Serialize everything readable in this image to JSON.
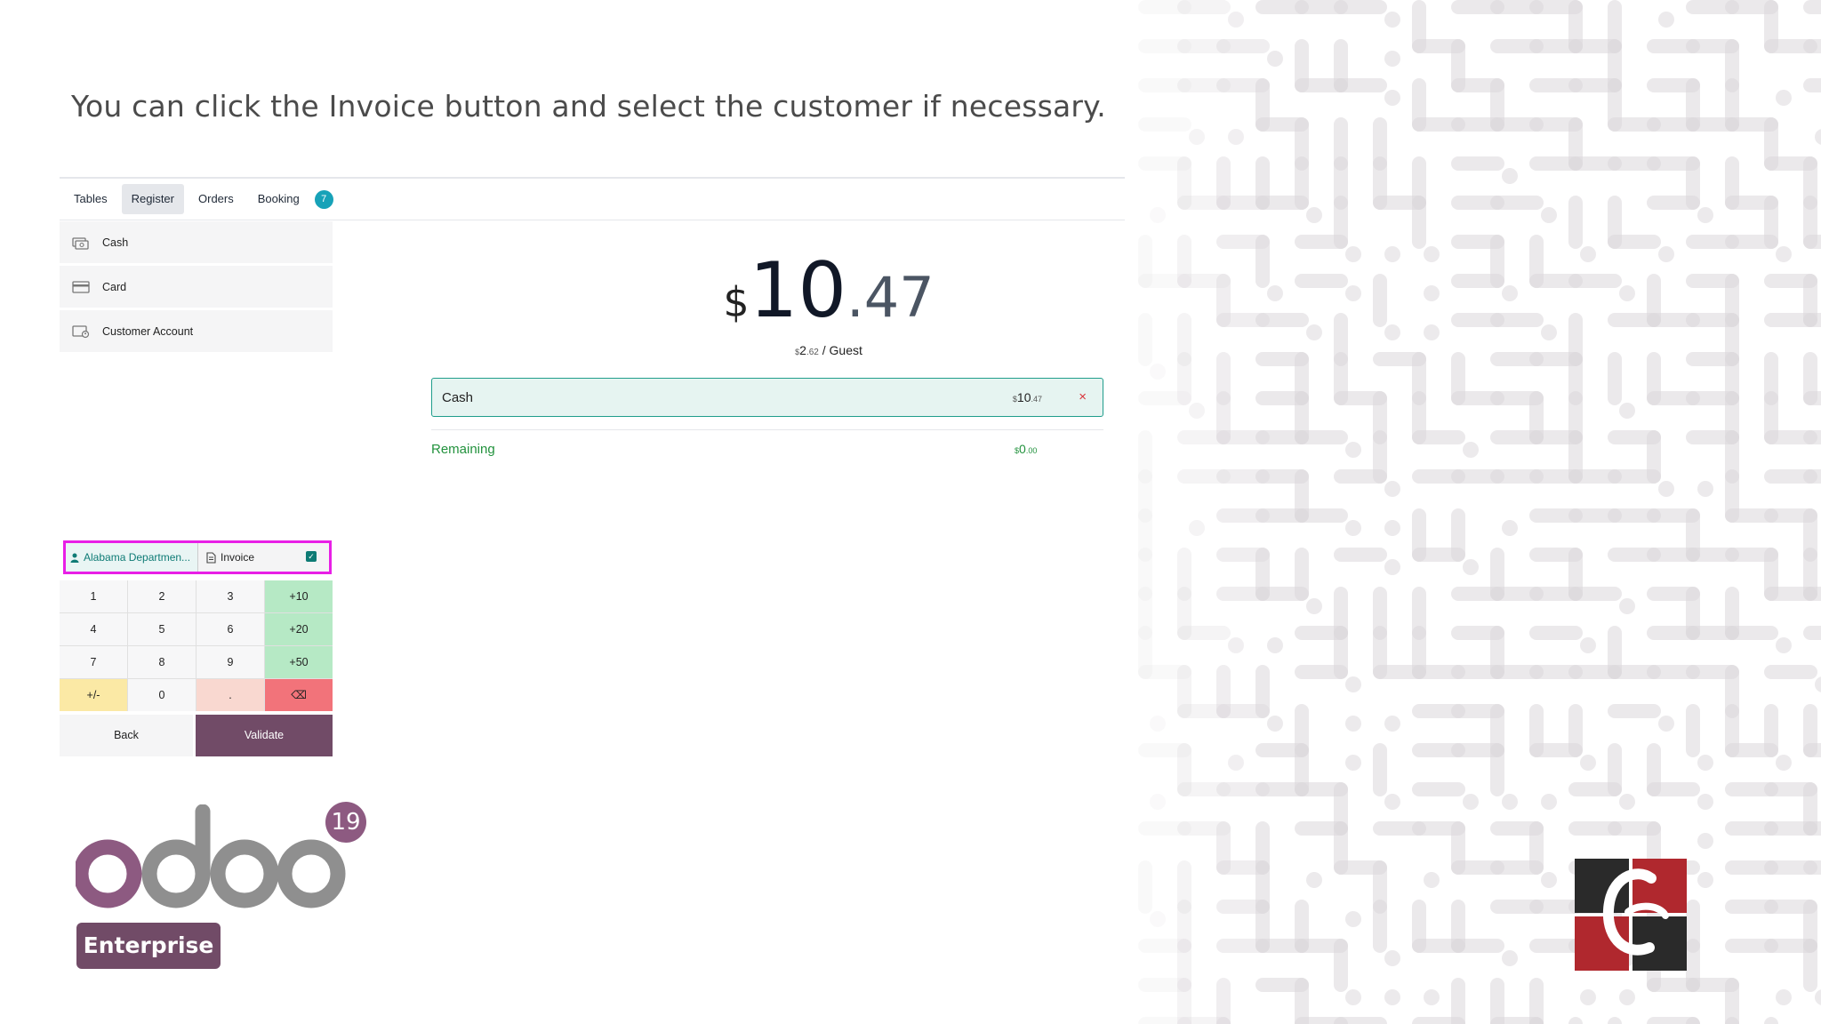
{
  "caption": "You can click the Invoice button and select the customer if necessary.",
  "topbar": {
    "tabs": [
      {
        "label": "Tables",
        "active": false
      },
      {
        "label": "Register",
        "active": true
      },
      {
        "label": "Orders",
        "active": false
      },
      {
        "label": "Booking",
        "active": false
      }
    ],
    "badge": "7"
  },
  "payment_methods": [
    {
      "label": "Cash",
      "icon": "cash-icon"
    },
    {
      "label": "Card",
      "icon": "card-icon"
    },
    {
      "label": "Customer Account",
      "icon": "customer-account-icon"
    }
  ],
  "total": {
    "currency": "$",
    "integer": "10",
    "decimal": ".47"
  },
  "per_guest": {
    "currency": "$",
    "integer": "2",
    "cents": ".62",
    "suffix": "/ Guest"
  },
  "payment_line": {
    "name": "Cash",
    "currency": "$",
    "integer": "10",
    "cents": ".47",
    "delete_symbol": "×"
  },
  "remaining": {
    "label": "Remaining",
    "currency": "$",
    "integer": "0",
    "cents": ".00"
  },
  "customer": {
    "label": "Alabama Departmen..."
  },
  "invoice": {
    "label": "Invoice",
    "checked": true
  },
  "numpad": [
    "1",
    "2",
    "3",
    "+10",
    "4",
    "5",
    "6",
    "+20",
    "7",
    "8",
    "9",
    "+50",
    "+/-",
    "0",
    ".",
    "⌫"
  ],
  "actions": {
    "back": "Back",
    "validate": "Validate"
  },
  "branding": {
    "badge": "19",
    "edition": "Enterprise"
  },
  "colors": {
    "brand": "#714b67",
    "accent": "#17a2b8",
    "success": "#22923d",
    "highlight": "#e81fe6"
  }
}
